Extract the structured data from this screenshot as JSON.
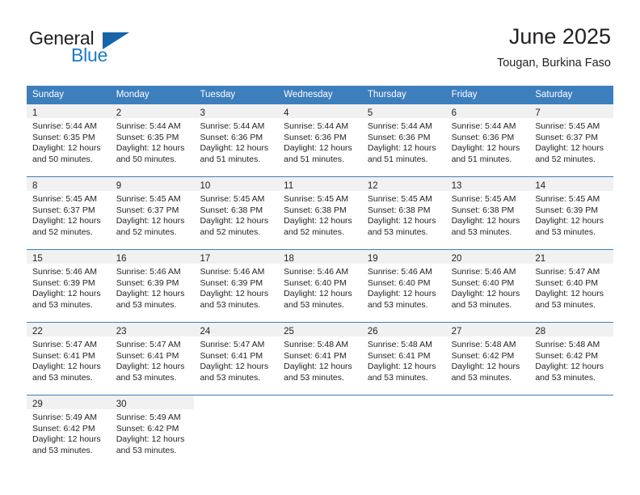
{
  "brand": {
    "name_top": "General",
    "name_bottom": "Blue",
    "accent_color": "#1d7cc4",
    "triangle_color": "#1565a8"
  },
  "header": {
    "title": "June 2025",
    "subtitle": "Tougan, Burkina Faso"
  },
  "theme": {
    "header_row_bg": "#3d7ebd",
    "day_band_bg": "#f1f1f1",
    "text_color": "#231f20",
    "page_bg": "#ffffff"
  },
  "weekdays": [
    "Sunday",
    "Monday",
    "Tuesday",
    "Wednesday",
    "Thursday",
    "Friday",
    "Saturday"
  ],
  "weeks": [
    [
      {
        "day": "1",
        "sunrise": "Sunrise: 5:44 AM",
        "sunset": "Sunset: 6:35 PM",
        "daylight1": "Daylight: 12 hours",
        "daylight2": "and 50 minutes."
      },
      {
        "day": "2",
        "sunrise": "Sunrise: 5:44 AM",
        "sunset": "Sunset: 6:35 PM",
        "daylight1": "Daylight: 12 hours",
        "daylight2": "and 50 minutes."
      },
      {
        "day": "3",
        "sunrise": "Sunrise: 5:44 AM",
        "sunset": "Sunset: 6:36 PM",
        "daylight1": "Daylight: 12 hours",
        "daylight2": "and 51 minutes."
      },
      {
        "day": "4",
        "sunrise": "Sunrise: 5:44 AM",
        "sunset": "Sunset: 6:36 PM",
        "daylight1": "Daylight: 12 hours",
        "daylight2": "and 51 minutes."
      },
      {
        "day": "5",
        "sunrise": "Sunrise: 5:44 AM",
        "sunset": "Sunset: 6:36 PM",
        "daylight1": "Daylight: 12 hours",
        "daylight2": "and 51 minutes."
      },
      {
        "day": "6",
        "sunrise": "Sunrise: 5:44 AM",
        "sunset": "Sunset: 6:36 PM",
        "daylight1": "Daylight: 12 hours",
        "daylight2": "and 51 minutes."
      },
      {
        "day": "7",
        "sunrise": "Sunrise: 5:45 AM",
        "sunset": "Sunset: 6:37 PM",
        "daylight1": "Daylight: 12 hours",
        "daylight2": "and 52 minutes."
      }
    ],
    [
      {
        "day": "8",
        "sunrise": "Sunrise: 5:45 AM",
        "sunset": "Sunset: 6:37 PM",
        "daylight1": "Daylight: 12 hours",
        "daylight2": "and 52 minutes."
      },
      {
        "day": "9",
        "sunrise": "Sunrise: 5:45 AM",
        "sunset": "Sunset: 6:37 PM",
        "daylight1": "Daylight: 12 hours",
        "daylight2": "and 52 minutes."
      },
      {
        "day": "10",
        "sunrise": "Sunrise: 5:45 AM",
        "sunset": "Sunset: 6:38 PM",
        "daylight1": "Daylight: 12 hours",
        "daylight2": "and 52 minutes."
      },
      {
        "day": "11",
        "sunrise": "Sunrise: 5:45 AM",
        "sunset": "Sunset: 6:38 PM",
        "daylight1": "Daylight: 12 hours",
        "daylight2": "and 52 minutes."
      },
      {
        "day": "12",
        "sunrise": "Sunrise: 5:45 AM",
        "sunset": "Sunset: 6:38 PM",
        "daylight1": "Daylight: 12 hours",
        "daylight2": "and 53 minutes."
      },
      {
        "day": "13",
        "sunrise": "Sunrise: 5:45 AM",
        "sunset": "Sunset: 6:38 PM",
        "daylight1": "Daylight: 12 hours",
        "daylight2": "and 53 minutes."
      },
      {
        "day": "14",
        "sunrise": "Sunrise: 5:45 AM",
        "sunset": "Sunset: 6:39 PM",
        "daylight1": "Daylight: 12 hours",
        "daylight2": "and 53 minutes."
      }
    ],
    [
      {
        "day": "15",
        "sunrise": "Sunrise: 5:46 AM",
        "sunset": "Sunset: 6:39 PM",
        "daylight1": "Daylight: 12 hours",
        "daylight2": "and 53 minutes."
      },
      {
        "day": "16",
        "sunrise": "Sunrise: 5:46 AM",
        "sunset": "Sunset: 6:39 PM",
        "daylight1": "Daylight: 12 hours",
        "daylight2": "and 53 minutes."
      },
      {
        "day": "17",
        "sunrise": "Sunrise: 5:46 AM",
        "sunset": "Sunset: 6:39 PM",
        "daylight1": "Daylight: 12 hours",
        "daylight2": "and 53 minutes."
      },
      {
        "day": "18",
        "sunrise": "Sunrise: 5:46 AM",
        "sunset": "Sunset: 6:40 PM",
        "daylight1": "Daylight: 12 hours",
        "daylight2": "and 53 minutes."
      },
      {
        "day": "19",
        "sunrise": "Sunrise: 5:46 AM",
        "sunset": "Sunset: 6:40 PM",
        "daylight1": "Daylight: 12 hours",
        "daylight2": "and 53 minutes."
      },
      {
        "day": "20",
        "sunrise": "Sunrise: 5:46 AM",
        "sunset": "Sunset: 6:40 PM",
        "daylight1": "Daylight: 12 hours",
        "daylight2": "and 53 minutes."
      },
      {
        "day": "21",
        "sunrise": "Sunrise: 5:47 AM",
        "sunset": "Sunset: 6:40 PM",
        "daylight1": "Daylight: 12 hours",
        "daylight2": "and 53 minutes."
      }
    ],
    [
      {
        "day": "22",
        "sunrise": "Sunrise: 5:47 AM",
        "sunset": "Sunset: 6:41 PM",
        "daylight1": "Daylight: 12 hours",
        "daylight2": "and 53 minutes."
      },
      {
        "day": "23",
        "sunrise": "Sunrise: 5:47 AM",
        "sunset": "Sunset: 6:41 PM",
        "daylight1": "Daylight: 12 hours",
        "daylight2": "and 53 minutes."
      },
      {
        "day": "24",
        "sunrise": "Sunrise: 5:47 AM",
        "sunset": "Sunset: 6:41 PM",
        "daylight1": "Daylight: 12 hours",
        "daylight2": "and 53 minutes."
      },
      {
        "day": "25",
        "sunrise": "Sunrise: 5:48 AM",
        "sunset": "Sunset: 6:41 PM",
        "daylight1": "Daylight: 12 hours",
        "daylight2": "and 53 minutes."
      },
      {
        "day": "26",
        "sunrise": "Sunrise: 5:48 AM",
        "sunset": "Sunset: 6:41 PM",
        "daylight1": "Daylight: 12 hours",
        "daylight2": "and 53 minutes."
      },
      {
        "day": "27",
        "sunrise": "Sunrise: 5:48 AM",
        "sunset": "Sunset: 6:42 PM",
        "daylight1": "Daylight: 12 hours",
        "daylight2": "and 53 minutes."
      },
      {
        "day": "28",
        "sunrise": "Sunrise: 5:48 AM",
        "sunset": "Sunset: 6:42 PM",
        "daylight1": "Daylight: 12 hours",
        "daylight2": "and 53 minutes."
      }
    ],
    [
      {
        "day": "29",
        "sunrise": "Sunrise: 5:49 AM",
        "sunset": "Sunset: 6:42 PM",
        "daylight1": "Daylight: 12 hours",
        "daylight2": "and 53 minutes."
      },
      {
        "day": "30",
        "sunrise": "Sunrise: 5:49 AM",
        "sunset": "Sunset: 6:42 PM",
        "daylight1": "Daylight: 12 hours",
        "daylight2": "and 53 minutes."
      },
      {
        "day": "",
        "sunrise": "",
        "sunset": "",
        "daylight1": "",
        "daylight2": ""
      },
      {
        "day": "",
        "sunrise": "",
        "sunset": "",
        "daylight1": "",
        "daylight2": ""
      },
      {
        "day": "",
        "sunrise": "",
        "sunset": "",
        "daylight1": "",
        "daylight2": ""
      },
      {
        "day": "",
        "sunrise": "",
        "sunset": "",
        "daylight1": "",
        "daylight2": ""
      },
      {
        "day": "",
        "sunrise": "",
        "sunset": "",
        "daylight1": "",
        "daylight2": ""
      }
    ]
  ]
}
